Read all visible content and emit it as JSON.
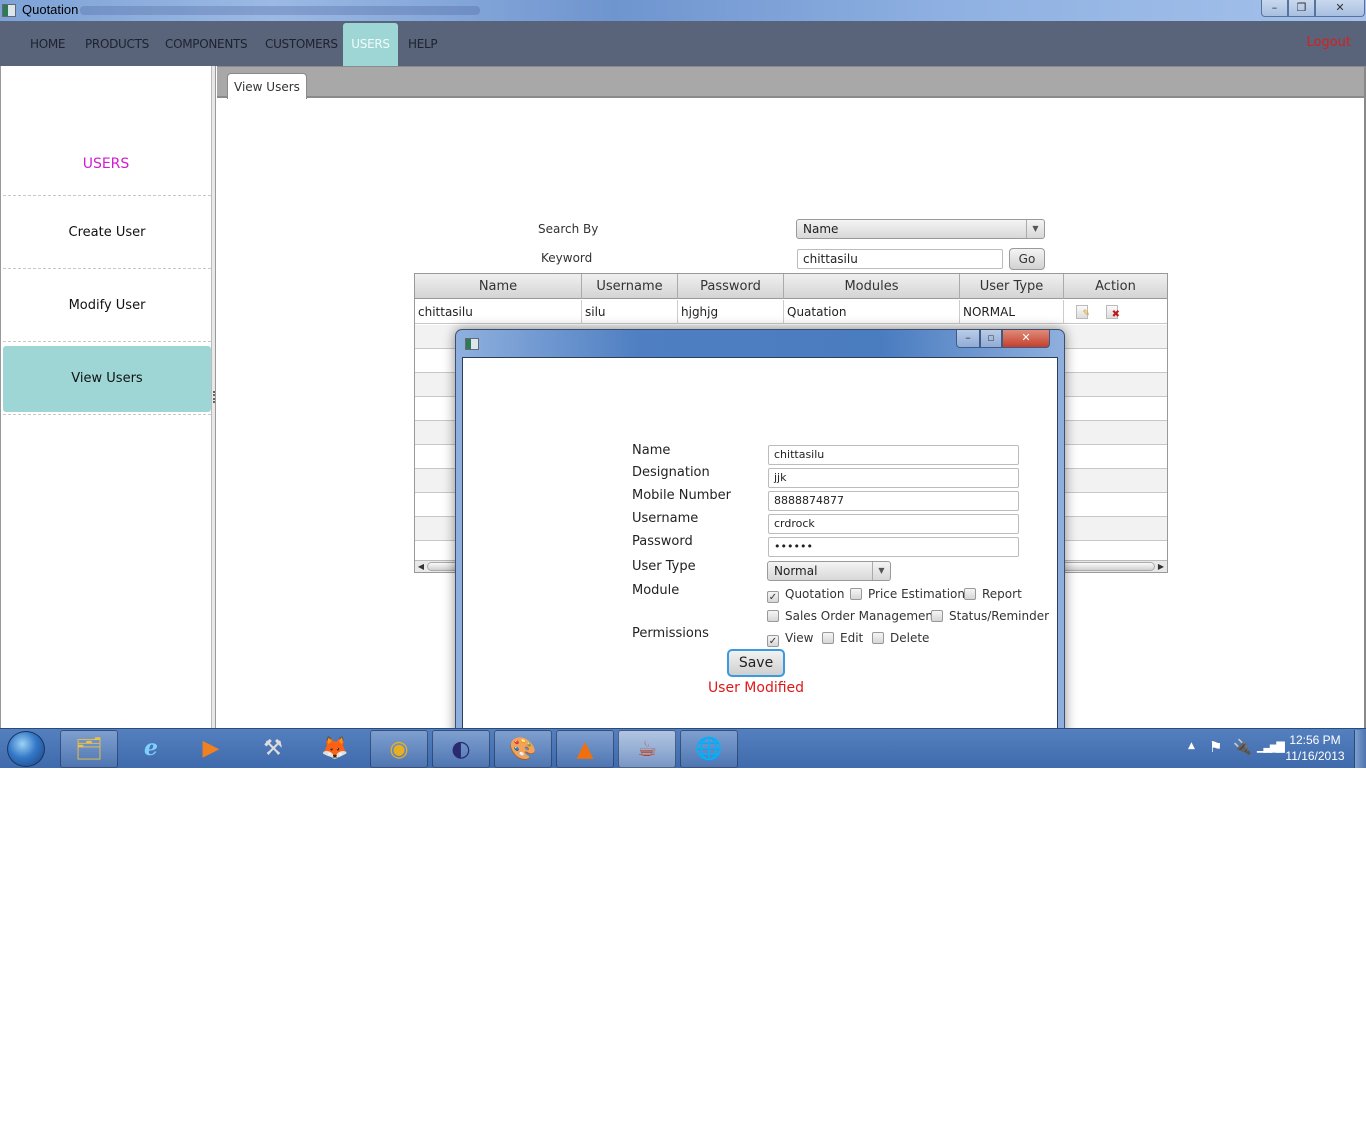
{
  "window": {
    "title": "Quotation",
    "controls": {
      "minimize": "–",
      "maximize": "❐",
      "close": "✕"
    }
  },
  "menubar": {
    "items": [
      {
        "label": "HOME",
        "active": false
      },
      {
        "label": "PRODUCTS",
        "active": false
      },
      {
        "label": "COMPONENTS",
        "active": false
      },
      {
        "label": "CUSTOMERS",
        "active": false
      },
      {
        "label": "USERS",
        "active": true
      },
      {
        "label": "HELP",
        "active": false
      }
    ],
    "logout": "Logout"
  },
  "sidebar": {
    "heading": "USERS",
    "items": [
      {
        "label": "Create User",
        "selected": false
      },
      {
        "label": "Modify User",
        "selected": false
      },
      {
        "label": "View Users",
        "selected": true
      }
    ]
  },
  "tabs": [
    {
      "label": "View Users",
      "active": true
    }
  ],
  "search": {
    "search_by_label": "Search By",
    "search_by_value": "Name",
    "keyword_label": "Keyword",
    "keyword_value": "chittasilu",
    "go_label": "Go"
  },
  "table": {
    "columns": [
      "Name",
      "Username",
      "Password",
      "Modules",
      "User Type",
      "Action"
    ],
    "rows": [
      {
        "name": "chittasilu",
        "username": "silu",
        "password": "hjghjg",
        "modules": "Quatation",
        "user_type": "NORMAL",
        "actions": [
          "edit-icon",
          "delete-icon"
        ]
      }
    ]
  },
  "dialog": {
    "controls": {
      "minimize": "–",
      "maximize": "▫",
      "close": "✕"
    },
    "fields": {
      "name": {
        "label": "Name",
        "value": "chittasilu"
      },
      "designation": {
        "label": "Designation",
        "value": "jjk"
      },
      "mobile": {
        "label": "Mobile Number",
        "value": "8888874877"
      },
      "username": {
        "label": "Username",
        "value": "crdrock"
      },
      "password": {
        "label": "Password",
        "value": "••••••"
      },
      "user_type": {
        "label": "User Type",
        "value": "Normal"
      }
    },
    "module_label": "Module",
    "modules": [
      {
        "label": "Quotation",
        "checked": true
      },
      {
        "label": "Price Estimation",
        "checked": false
      },
      {
        "label": "Report",
        "checked": false
      },
      {
        "label": "Sales Order Management",
        "checked": false
      },
      {
        "label": "Status/Reminder",
        "checked": false
      }
    ],
    "permissions_label": "Permissions",
    "permissions": [
      {
        "label": "View",
        "checked": true
      },
      {
        "label": "Edit",
        "checked": false
      },
      {
        "label": "Delete",
        "checked": false
      }
    ],
    "save_label": "Save",
    "status_message": "User Modified",
    "status_color": "#e01818"
  },
  "taskbar": {
    "apps": [
      {
        "name": "windows-explorer",
        "glyph": "🗂"
      },
      {
        "name": "internet-explorer",
        "glyph": "ℯ"
      },
      {
        "name": "media-player",
        "glyph": "▶"
      },
      {
        "name": "tools",
        "glyph": "⚒"
      },
      {
        "name": "firefox",
        "glyph": "🦊"
      },
      {
        "name": "chrome",
        "glyph": "◉"
      },
      {
        "name": "eclipse",
        "glyph": "◐"
      },
      {
        "name": "paint",
        "glyph": "🎨"
      },
      {
        "name": "vlc",
        "glyph": "▲"
      },
      {
        "name": "java",
        "glyph": "☕"
      },
      {
        "name": "internet-download-manager",
        "glyph": "🌐"
      }
    ],
    "tray": {
      "time": "12:56 PM",
      "date": "11/16/2013"
    }
  },
  "colors": {
    "menubar_bg": "#596379",
    "accent": "#9ed6d6",
    "sidebar_heading": "#d21bd2",
    "logout": "#d42020"
  }
}
